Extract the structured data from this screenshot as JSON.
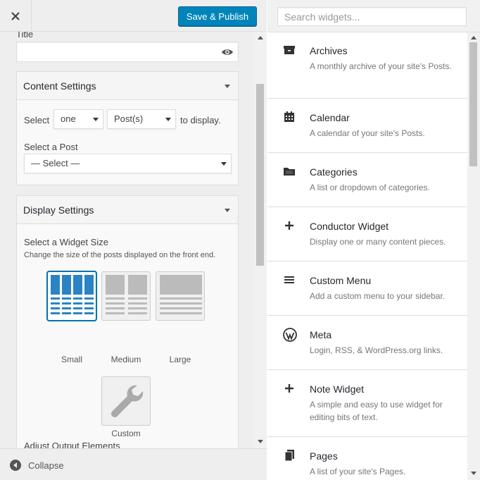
{
  "header": {
    "save_label": "Save & Publish"
  },
  "form": {
    "title_label": "Title",
    "content_settings": {
      "heading": "Content Settings",
      "select_label": "Select",
      "count_value": "one",
      "type_value": "Post(s)",
      "suffix": "to display.",
      "post_label": "Select a Post",
      "post_value": "— Select —"
    },
    "display_settings": {
      "heading": "Display Settings",
      "size_label": "Select a Widget Size",
      "size_help": "Change the size of the posts displayed on the front end.",
      "sizes": [
        "Small",
        "Medium",
        "Large",
        "Custom"
      ],
      "active_size": "Small",
      "output_label": "Adjust Output Elements"
    }
  },
  "footer": {
    "collapse_label": "Collapse"
  },
  "search": {
    "placeholder": "Search widgets..."
  },
  "widgets": [
    {
      "name": "Archives",
      "desc": "A monthly archive of your site's Posts.",
      "icon": "archive-icon"
    },
    {
      "name": "Calendar",
      "desc": "A calendar of your site's Posts.",
      "icon": "calendar-icon"
    },
    {
      "name": "Categories",
      "desc": "A list or dropdown of categories.",
      "icon": "folder-icon"
    },
    {
      "name": "Conductor Widget",
      "desc": "Display one or many content pieces.",
      "icon": "plus-icon"
    },
    {
      "name": "Custom Menu",
      "desc": "Add a custom menu to your sidebar.",
      "icon": "menu-icon"
    },
    {
      "name": "Meta",
      "desc": "Login, RSS, & WordPress.org links.",
      "icon": "wordpress-icon"
    },
    {
      "name": "Note Widget",
      "desc": "A simple and easy to use widget for editing bits of text.",
      "icon": "plus-icon"
    },
    {
      "name": "Pages",
      "desc": "A list of your site's Pages.",
      "icon": "pages-icon"
    }
  ],
  "colors": {
    "accent": "#0085ba",
    "active_size": "#0073aa"
  }
}
